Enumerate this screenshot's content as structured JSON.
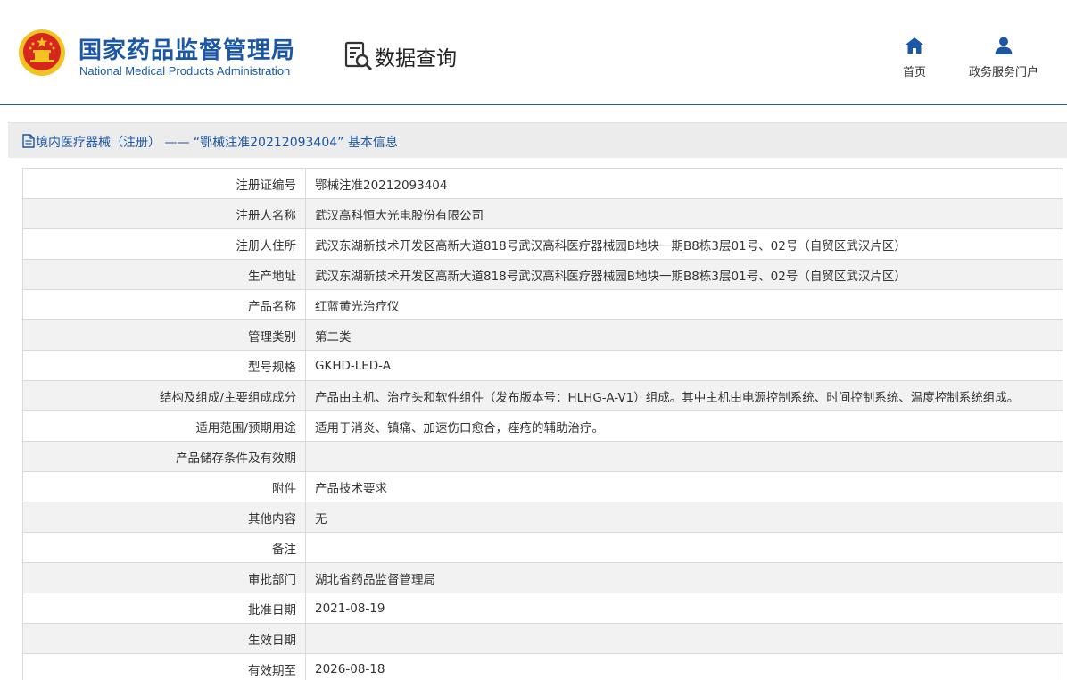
{
  "header": {
    "org_name_cn": "国家药品监督管理局",
    "org_name_en": "National Medical Products Administration",
    "section_title": "数据查询",
    "emblem_icon": "national-emblem-icon",
    "search_icon": "data-query-icon",
    "nav": [
      {
        "label": "首页",
        "icon": "home-icon"
      },
      {
        "label": "政务服务门户",
        "icon": "user-icon"
      }
    ]
  },
  "title_bar": {
    "icon": "document-icon",
    "text": "境内医疗器械（注册） —— “鄂械注准20212093404” 基本信息"
  },
  "rows": [
    {
      "label": "注册证编号",
      "value": "鄂械注准20212093404"
    },
    {
      "label": "注册人名称",
      "value": "武汉高科恒大光电股份有限公司"
    },
    {
      "label": "注册人住所",
      "value": "武汉东湖新技术开发区高新大道818号武汉高科医疗器械园B地块一期B8栋3层01号、02号（自贸区武汉片区）"
    },
    {
      "label": "生产地址",
      "value": "武汉东湖新技术开发区高新大道818号武汉高科医疗器械园B地块一期B8栋3层01号、02号（自贸区武汉片区）"
    },
    {
      "label": "产品名称",
      "value": "红蓝黄光治疗仪"
    },
    {
      "label": "管理类别",
      "value": "第二类"
    },
    {
      "label": "型号规格",
      "value": "GKHD-LED-A"
    },
    {
      "label": "结构及组成/主要组成成分",
      "value": "产品由主机、治疗头和软件组件（发布版本号：HLHG-A-V1）组成。其中主机由电源控制系统、时间控制系统、温度控制系统组成。"
    },
    {
      "label": "适用范围/预期用途",
      "value": "适用于消炎、镇痛、加速伤口愈合，痤疮的辅助治疗。"
    },
    {
      "label": "产品储存条件及有效期",
      "value": ""
    },
    {
      "label": "附件",
      "value": "产品技术要求"
    },
    {
      "label": "其他内容",
      "value": "无"
    },
    {
      "label": "备注",
      "value": ""
    },
    {
      "label": "审批部门",
      "value": "湖北省药品监督管理局"
    },
    {
      "label": "批准日期",
      "value": "2021-08-19"
    },
    {
      "label": "生效日期",
      "value": ""
    },
    {
      "label": "有效期至",
      "value": "2026-08-18"
    }
  ],
  "colors": {
    "brand_blue": "#1b57a6",
    "emblem_red": "#d7261e",
    "emblem_gold": "#f3c323"
  }
}
